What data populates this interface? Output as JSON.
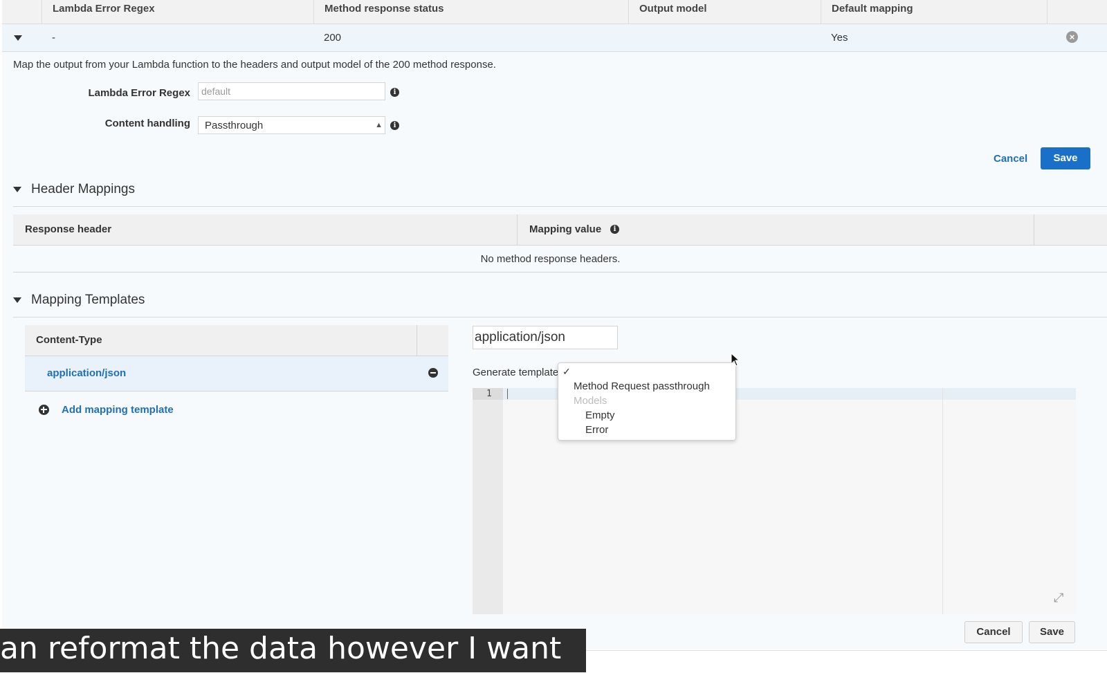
{
  "table": {
    "columns": [
      "Lambda Error Regex",
      "Method response status",
      "Output model",
      "Default mapping"
    ],
    "row": {
      "regex": "-",
      "status": "200",
      "output_model": "",
      "default_mapping": "Yes"
    }
  },
  "response": {
    "description": "Map the output from your Lambda function to the headers and output model of the 200 method response.",
    "lambda_error_regex_label": "Lambda Error Regex",
    "lambda_error_regex_placeholder": "default",
    "content_handling_label": "Content handling",
    "content_handling_value": "Passthrough",
    "cancel_label": "Cancel",
    "save_label": "Save"
  },
  "header_mappings": {
    "title": "Header Mappings",
    "col_response_header": "Response header",
    "col_mapping_value": "Mapping value",
    "empty_text": "No method response headers."
  },
  "mapping_templates": {
    "title": "Mapping Templates",
    "col_content_type": "Content-Type",
    "items": [
      "application/json"
    ],
    "add_label": "Add mapping template",
    "content_type_input": "application/json",
    "generate_label": "Generate template",
    "line_number": "1",
    "cancel_label": "Cancel",
    "save_label": "Save"
  },
  "dropdown": {
    "check": "✓",
    "options": [
      "Method Request passthrough"
    ],
    "group_label": "Models",
    "group_options": [
      "Empty",
      "Error"
    ]
  },
  "caption": "an reformat the data however I want"
}
